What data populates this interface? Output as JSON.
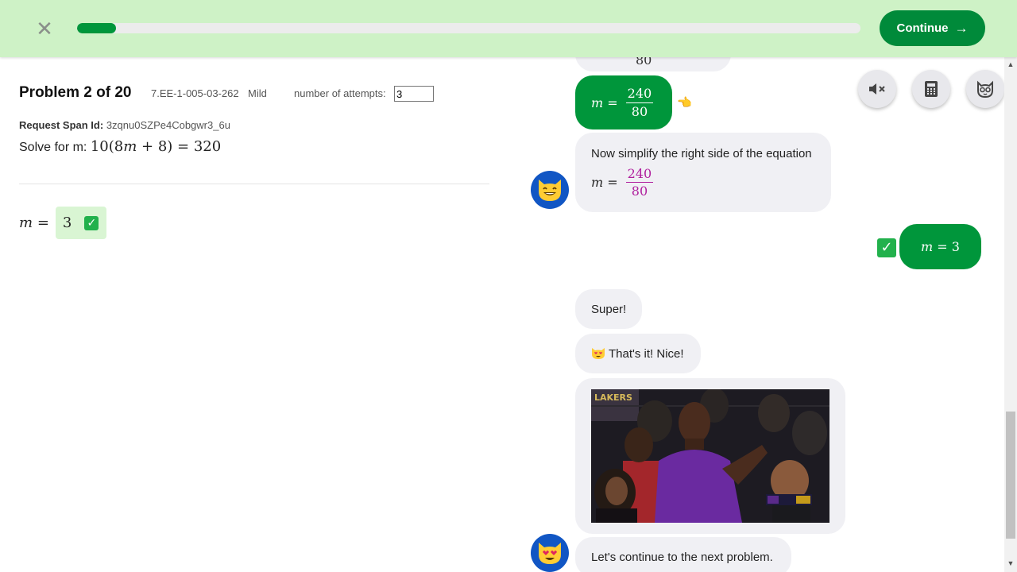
{
  "topbar": {
    "close_icon": "close-icon",
    "progress_fraction": 0.05,
    "continue_label": "Continue",
    "continue_arrow": "→",
    "colors": {
      "bar_bg": "#cef2c6",
      "accent": "#00963b"
    }
  },
  "problem": {
    "title": "Problem 2 of 20",
    "code": "7.EE-1-005-03-262",
    "difficulty": "Mild",
    "attempts_label": "number of attempts:",
    "attempts_value": "3",
    "span_id_label": "Request Span Id:",
    "span_id_value": "3zqnu0SZPe4Cobgwr3_6u",
    "solve_prefix": "Solve for m:",
    "equation": {
      "a": "10",
      "b": "8",
      "var": "m",
      "c": "8",
      "rhs": "320"
    },
    "answer": {
      "var": "m",
      "eq": "=",
      "value": "3"
    }
  },
  "chat": {
    "partial_top_text": "80",
    "msg_user_frac": {
      "var": "m",
      "eq": "=",
      "num": "240",
      "den": "80"
    },
    "pointer_emoji": "👈",
    "msg_tutor_simplify": {
      "text": "Now simplify the right side of the equation",
      "var": "m",
      "eq": "=",
      "num": "240",
      "den": "80"
    },
    "msg_user_answer": {
      "var": "m",
      "eq": "=",
      "value": "3"
    },
    "msg_super": "Super!",
    "msg_thats_it": "That's it! Nice!",
    "msg_continue": "Let's continue to the next problem.",
    "gif_alt": "celebration-gif",
    "colors": {
      "magenta": "#b0209e",
      "avatar": "#1156c4"
    }
  },
  "tools": {
    "mute_icon": "speaker-muted-icon",
    "calculator_icon": "calculator-icon",
    "avatar_icon": "cat-face-icon"
  }
}
